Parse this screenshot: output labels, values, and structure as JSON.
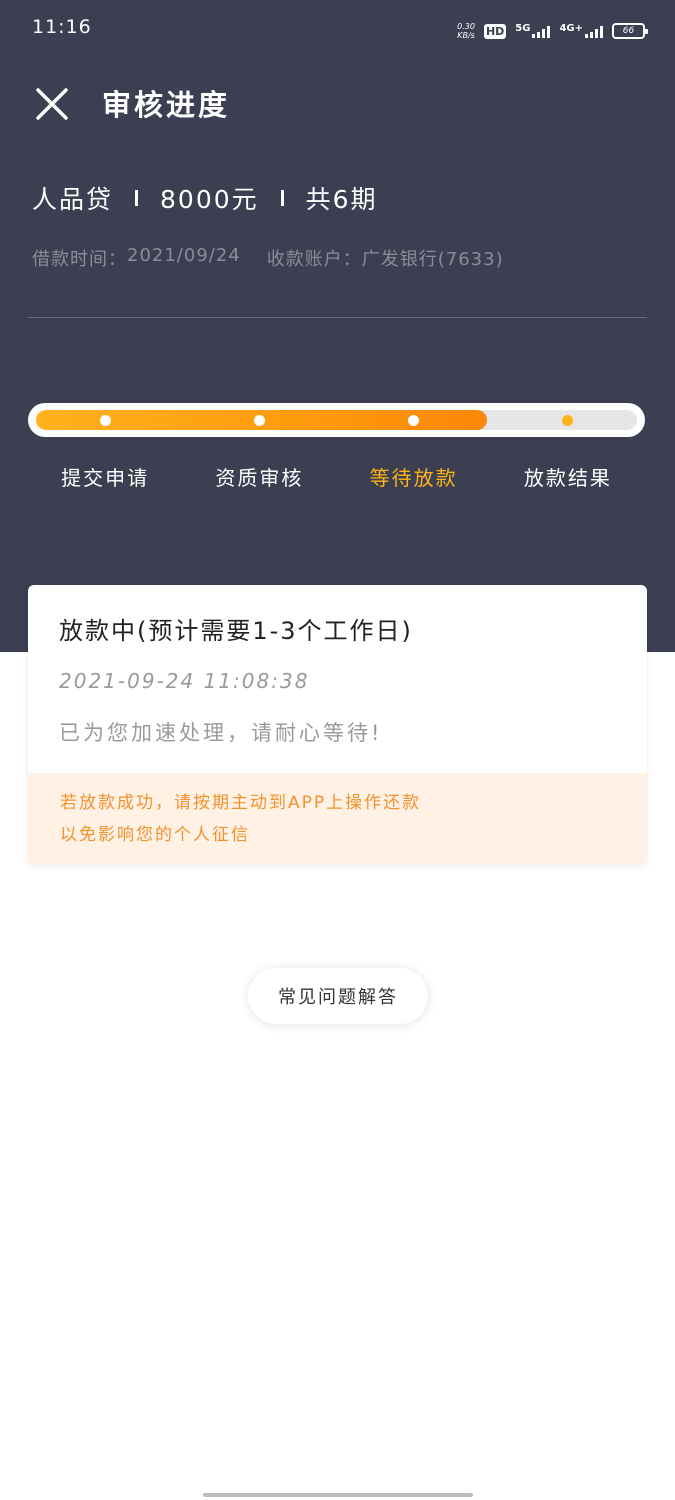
{
  "status_bar": {
    "time": "11:16",
    "net_speed_value": "0.30",
    "net_speed_unit": "KB/s",
    "hd_label": "HD",
    "sim1_label": "5G",
    "sim2_label": "4G+",
    "battery": "66"
  },
  "header": {
    "title": "审核进度",
    "close_icon": "close-icon"
  },
  "loan": {
    "product": "人品贷",
    "amount": "8000元",
    "periods": "共6期",
    "date_label": "借款时间：",
    "date_value": "2021/09/24",
    "account_label": "收款账户：",
    "account_value": "广发银行(7633)"
  },
  "progress": {
    "fraction": 0.75,
    "steps": [
      {
        "label": "提交申请",
        "state": "done"
      },
      {
        "label": "资质审核",
        "state": "done"
      },
      {
        "label": "等待放款",
        "state": "active"
      },
      {
        "label": "放款结果",
        "state": "pending"
      }
    ],
    "colors": {
      "fill_start": "#ffb21b",
      "fill_end": "#fb8708",
      "active_text": "#fdb416",
      "header_bg": "#3b3f51"
    }
  },
  "card": {
    "title": "放款中(预计需要1-3个工作日)",
    "timestamp": "2021-09-24 11:08:38",
    "message": "已为您加速处理，请耐心等待!",
    "notice_line1": "若放款成功，请按期主动到APP上操作还款",
    "notice_line2": "以免影响您的个人征信"
  },
  "faq_button": {
    "label": "常见问题解答"
  }
}
